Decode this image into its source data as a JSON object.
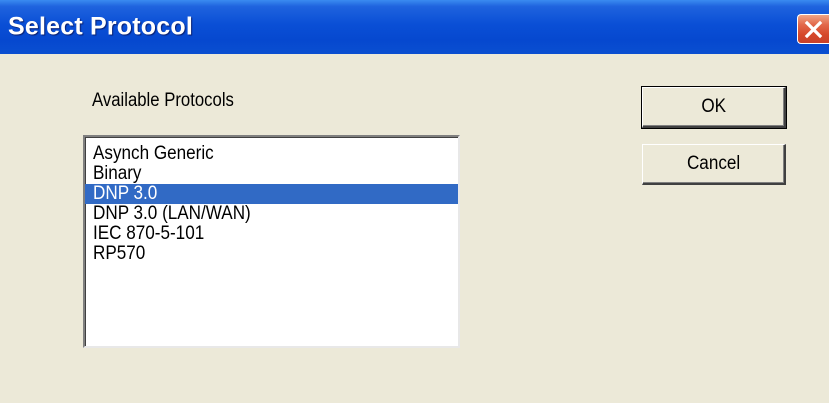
{
  "window": {
    "title": "Select Protocol"
  },
  "titlebar": {
    "close_icon": "close-icon"
  },
  "dialog": {
    "list_label": "Available Protocols",
    "protocols": [
      "Asynch Generic",
      "Binary",
      "DNP 3.0",
      "DNP 3.0 (LAN/WAN)",
      "IEC 870-5-101",
      "RP570"
    ],
    "selected_protocol": "DNP 3.0",
    "ok_label": "OK",
    "cancel_label": "Cancel"
  },
  "colors": {
    "titlebar": "#0a4fd6",
    "selection": "#316ac5",
    "face": "#ece9d8",
    "close_button": "#d6482a"
  }
}
